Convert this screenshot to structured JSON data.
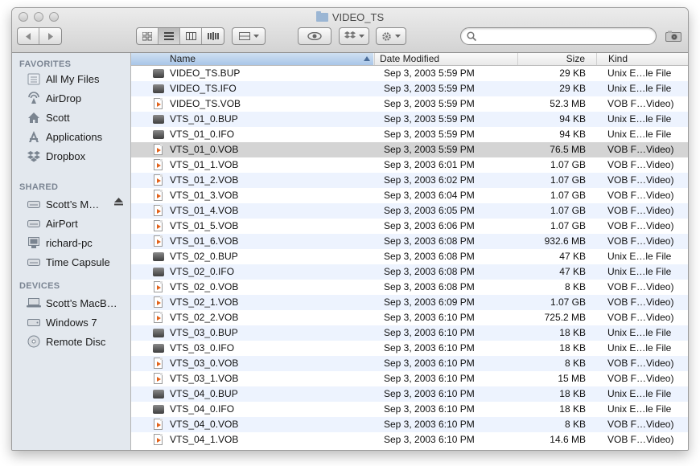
{
  "window": {
    "title": "VIDEO_TS"
  },
  "toolbar": {
    "nav": [
      "back",
      "forward"
    ],
    "view_modes": [
      "icon-view",
      "list-view",
      "column-view",
      "coverflow-view"
    ],
    "active_view": "list-view",
    "search": {
      "value": "",
      "placeholder": ""
    }
  },
  "sidebar": {
    "sections": [
      {
        "title": "FAVORITES",
        "items": [
          {
            "label": "All My Files",
            "icon": "all-files-icon"
          },
          {
            "label": "AirDrop",
            "icon": "airdrop-icon"
          },
          {
            "label": "Scott",
            "icon": "home-icon"
          },
          {
            "label": "Applications",
            "icon": "applications-icon"
          },
          {
            "label": "Dropbox",
            "icon": "dropbox-icon"
          }
        ]
      },
      {
        "title": "SHARED",
        "items": [
          {
            "label": "Scott’s M…",
            "icon": "server-icon"
          },
          {
            "label": "AirPort",
            "icon": "server-icon"
          },
          {
            "label": "richard-pc",
            "icon": "pc-icon"
          },
          {
            "label": "Time Capsule",
            "icon": "server-icon"
          }
        ]
      },
      {
        "title": "DEVICES",
        "items": [
          {
            "label": "Scott’s MacB…",
            "icon": "laptop-icon"
          },
          {
            "label": "Windows 7",
            "icon": "disk-icon"
          },
          {
            "label": "Remote Disc",
            "icon": "disc-icon"
          }
        ]
      }
    ]
  },
  "columns": {
    "name": "Name",
    "date": "Date Modified",
    "size": "Size",
    "kind": "Kind"
  },
  "files": [
    {
      "name": "VIDEO_TS.BUP",
      "date": "Sep 3, 2003 5:59 PM",
      "size": "29 KB",
      "kind": "Unix E…le File",
      "icon": "generic"
    },
    {
      "name": "VIDEO_TS.IFO",
      "date": "Sep 3, 2003 5:59 PM",
      "size": "29 KB",
      "kind": "Unix E…le File",
      "icon": "generic"
    },
    {
      "name": "VIDEO_TS.VOB",
      "date": "Sep 3, 2003 5:59 PM",
      "size": "52.3 MB",
      "kind": "VOB F…Video)",
      "icon": "vob"
    },
    {
      "name": "VTS_01_0.BUP",
      "date": "Sep 3, 2003 5:59 PM",
      "size": "94 KB",
      "kind": "Unix E…le File",
      "icon": "generic"
    },
    {
      "name": "VTS_01_0.IFO",
      "date": "Sep 3, 2003 5:59 PM",
      "size": "94 KB",
      "kind": "Unix E…le File",
      "icon": "generic"
    },
    {
      "name": "VTS_01_0.VOB",
      "date": "Sep 3, 2003 5:59 PM",
      "size": "76.5 MB",
      "kind": "VOB F…Video)",
      "icon": "vob"
    },
    {
      "name": "VTS_01_1.VOB",
      "date": "Sep 3, 2003 6:01 PM",
      "size": "1.07 GB",
      "kind": "VOB F…Video)",
      "icon": "vob"
    },
    {
      "name": "VTS_01_2.VOB",
      "date": "Sep 3, 2003 6:02 PM",
      "size": "1.07 GB",
      "kind": "VOB F…Video)",
      "icon": "vob"
    },
    {
      "name": "VTS_01_3.VOB",
      "date": "Sep 3, 2003 6:04 PM",
      "size": "1.07 GB",
      "kind": "VOB F…Video)",
      "icon": "vob"
    },
    {
      "name": "VTS_01_4.VOB",
      "date": "Sep 3, 2003 6:05 PM",
      "size": "1.07 GB",
      "kind": "VOB F…Video)",
      "icon": "vob"
    },
    {
      "name": "VTS_01_5.VOB",
      "date": "Sep 3, 2003 6:06 PM",
      "size": "1.07 GB",
      "kind": "VOB F…Video)",
      "icon": "vob"
    },
    {
      "name": "VTS_01_6.VOB",
      "date": "Sep 3, 2003 6:08 PM",
      "size": "932.6 MB",
      "kind": "VOB F…Video)",
      "icon": "vob"
    },
    {
      "name": "VTS_02_0.BUP",
      "date": "Sep 3, 2003 6:08 PM",
      "size": "47 KB",
      "kind": "Unix E…le File",
      "icon": "generic"
    },
    {
      "name": "VTS_02_0.IFO",
      "date": "Sep 3, 2003 6:08 PM",
      "size": "47 KB",
      "kind": "Unix E…le File",
      "icon": "generic"
    },
    {
      "name": "VTS_02_0.VOB",
      "date": "Sep 3, 2003 6:08 PM",
      "size": "8 KB",
      "kind": "VOB F…Video)",
      "icon": "vob"
    },
    {
      "name": "VTS_02_1.VOB",
      "date": "Sep 3, 2003 6:09 PM",
      "size": "1.07 GB",
      "kind": "VOB F…Video)",
      "icon": "vob"
    },
    {
      "name": "VTS_02_2.VOB",
      "date": "Sep 3, 2003 6:10 PM",
      "size": "725.2 MB",
      "kind": "VOB F…Video)",
      "icon": "vob"
    },
    {
      "name": "VTS_03_0.BUP",
      "date": "Sep 3, 2003 6:10 PM",
      "size": "18 KB",
      "kind": "Unix E…le File",
      "icon": "generic"
    },
    {
      "name": "VTS_03_0.IFO",
      "date": "Sep 3, 2003 6:10 PM",
      "size": "18 KB",
      "kind": "Unix E…le File",
      "icon": "generic"
    },
    {
      "name": "VTS_03_0.VOB",
      "date": "Sep 3, 2003 6:10 PM",
      "size": "8 KB",
      "kind": "VOB F…Video)",
      "icon": "vob"
    },
    {
      "name": "VTS_03_1.VOB",
      "date": "Sep 3, 2003 6:10 PM",
      "size": "15 MB",
      "kind": "VOB F…Video)",
      "icon": "vob"
    },
    {
      "name": "VTS_04_0.BUP",
      "date": "Sep 3, 2003 6:10 PM",
      "size": "18 KB",
      "kind": "Unix E…le File",
      "icon": "generic"
    },
    {
      "name": "VTS_04_0.IFO",
      "date": "Sep 3, 2003 6:10 PM",
      "size": "18 KB",
      "kind": "Unix E…le File",
      "icon": "generic"
    },
    {
      "name": "VTS_04_0.VOB",
      "date": "Sep 3, 2003 6:10 PM",
      "size": "8 KB",
      "kind": "VOB F…Video)",
      "icon": "vob"
    },
    {
      "name": "VTS_04_1.VOB",
      "date": "Sep 3, 2003 6:10 PM",
      "size": "14.6 MB",
      "kind": "VOB F…Video)",
      "icon": "vob"
    }
  ],
  "selected_file": "VTS_01_0.VOB"
}
